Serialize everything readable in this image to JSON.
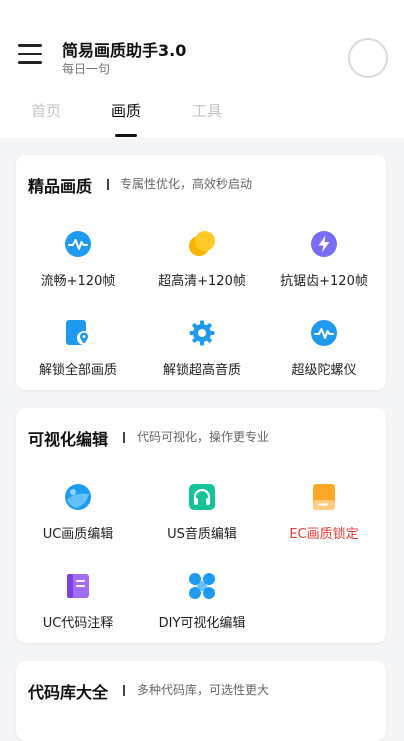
{
  "header": {
    "title": "简易画质助手3.0",
    "subtitle": "每日一句"
  },
  "tabs": [
    {
      "label": "首页"
    },
    {
      "label": "画质"
    },
    {
      "label": "工具"
    }
  ],
  "active_tab": "画质",
  "sections": [
    {
      "title": "精品画质",
      "desc": "专属性优化，高效秒启动",
      "items": [
        {
          "label": "流畅+120帧",
          "icon": "pulse-icon"
        },
        {
          "label": "超高清+120帧",
          "icon": "coins-icon"
        },
        {
          "label": "抗锯齿+120帧",
          "icon": "lightning-icon"
        },
        {
          "label": "解锁全部画质",
          "icon": "location-file-icon"
        },
        {
          "label": "解锁超高音质",
          "icon": "gear-icon"
        },
        {
          "label": "超级陀螺仪",
          "icon": "pulse-icon"
        }
      ]
    },
    {
      "title": "可视化编辑",
      "desc": "代码可视化，操作更专业",
      "items": [
        {
          "label": "UC画质编辑",
          "icon": "globe-icon"
        },
        {
          "label": "US音质编辑",
          "icon": "headphones-icon"
        },
        {
          "label": "EC画质锁定",
          "icon": "document-icon",
          "color": "#e53935"
        },
        {
          "label": "UC代码注释",
          "icon": "book-icon"
        },
        {
          "label": "DIY可视化编辑",
          "icon": "puzzle-icon"
        }
      ]
    },
    {
      "title": "代码库大全",
      "desc": "多种代码库，可选性更大",
      "items": []
    }
  ],
  "colors": {
    "page_bg": "#f4f5f7",
    "blue": "#1e9bf0",
    "yellow": "#f9b400",
    "purple": "#7b6cf6",
    "teal": "#15c39a",
    "orange": "#ffa726",
    "red": "#e53935"
  }
}
